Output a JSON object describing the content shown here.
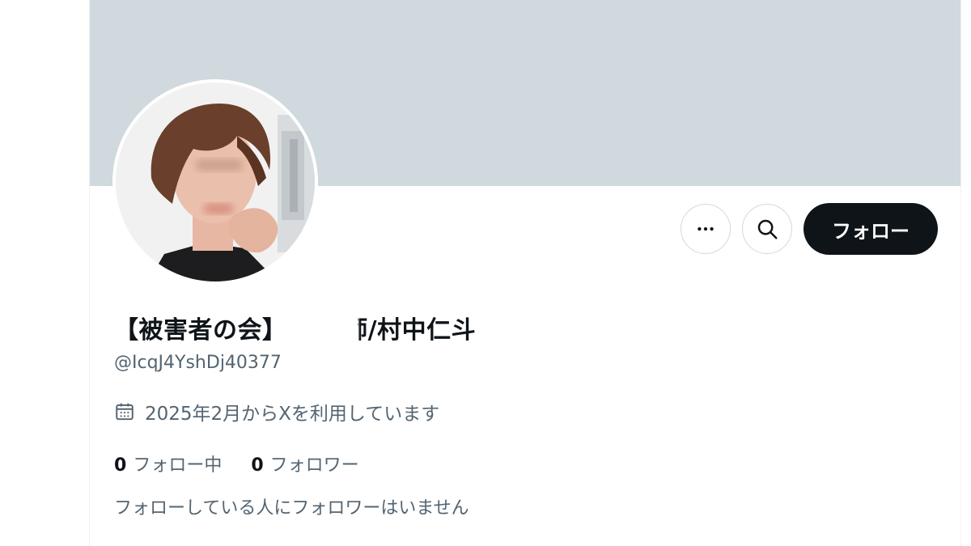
{
  "profile": {
    "display_name": "【被害者の会】　　X師/村中仁斗",
    "handle": "@IcqJ4YshDj40377",
    "joined": "2025年2月からXを利用しています",
    "following_count": "0",
    "following_label": "フォロー中",
    "followers_count": "0",
    "followers_label": "フォロワー",
    "followers_you_know": "フォローしている人にフォロワーはいません"
  },
  "actions": {
    "more_icon": "more-horizontal-icon",
    "search_icon": "search-icon",
    "follow_label": "フォロー"
  },
  "colors": {
    "banner": "#cfd9de",
    "follow_button": "#0f1419",
    "secondary_text": "#536471",
    "primary_text": "#0f1419"
  }
}
